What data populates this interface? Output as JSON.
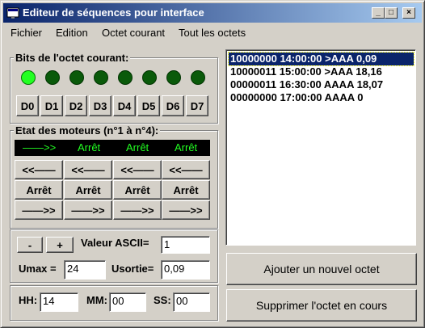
{
  "window": {
    "title": "Editeur de séquences pour interface"
  },
  "menu": {
    "items": [
      "Fichier",
      "Edition",
      "Octet courant",
      "Tout les octets"
    ]
  },
  "bits": {
    "legend": "Bits de l'octet courant:",
    "leds": [
      true,
      false,
      false,
      false,
      false,
      false,
      false,
      false
    ],
    "buttons": [
      "D0",
      "D1",
      "D2",
      "D3",
      "D4",
      "D5",
      "D6",
      "D7"
    ]
  },
  "motors": {
    "legend": "Etat des moteurs (n°1 à n°4):",
    "status": [
      "——>>",
      "Arrêt",
      "Arrêt",
      "Arrêt"
    ],
    "back_label": "<<——",
    "stop_label": "Arrêt",
    "forward_label": "——>>"
  },
  "ascii": {
    "minus_label": "-",
    "plus_label": "+",
    "label": "Valeur ASCII=",
    "value": "1",
    "umax_label": "Umax =",
    "umax_value": "24",
    "usortie_label": "Usortie=",
    "usortie_value": "0,09"
  },
  "time": {
    "hh_label": "HH:",
    "hh_value": "14",
    "mm_label": "MM:",
    "mm_value": "00",
    "ss_label": "SS:",
    "ss_value": "00"
  },
  "list": {
    "items": [
      "10000000 14:00:00  >AAA 0,09",
      "10000011 15:00:00  >AAA 18,16",
      "00000011 16:30:00  AAAA 18,07",
      "00000000 17:00:00  AAAA 0"
    ],
    "selected_index": 0
  },
  "actions": {
    "add_label": "Ajouter un nouvel octet",
    "delete_label": "Supprimer l'octet en cours"
  },
  "colors": {
    "led_on": "#22ff22",
    "led_off": "#0a5a0a",
    "status_text": "#22ff22",
    "selection": "#0a246a"
  }
}
